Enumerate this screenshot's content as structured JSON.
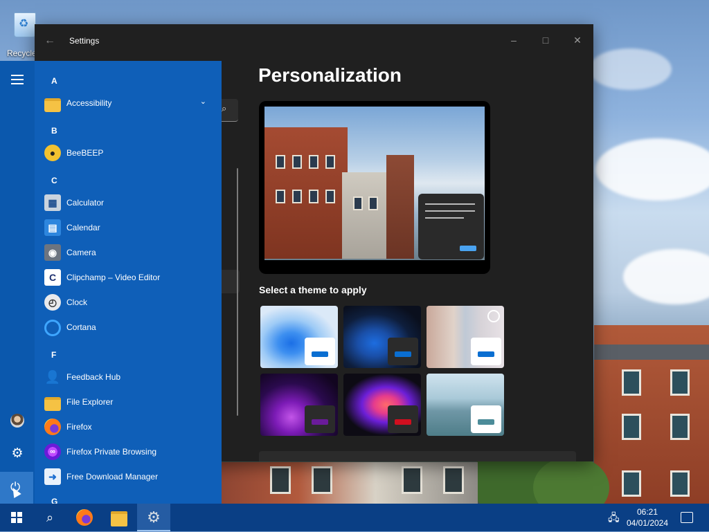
{
  "desktop": {
    "recycle_bin_label": "Recycle"
  },
  "settings_window": {
    "title": "Settings",
    "back_icon": "arrow-left-icon",
    "controls": {
      "minimize": "–",
      "maximize": "□",
      "close": "✕"
    },
    "page_title": "Personalization",
    "theme_section_label": "Select a theme to apply",
    "themes": [
      {
        "name": "windows-light",
        "accent": "#0a6ed1"
      },
      {
        "name": "windows-dark",
        "accent": "#0a6ed1"
      },
      {
        "name": "captured-motion",
        "accent": "#0a6ed1"
      },
      {
        "name": "glow",
        "accent": "#6a1b9a"
      },
      {
        "name": "captured-flow",
        "accent": "#d10f1f"
      },
      {
        "name": "sunrise",
        "accent": "#4c8c99"
      }
    ]
  },
  "start_menu": {
    "groups": [
      {
        "letter": "A",
        "apps": [
          {
            "label": "Accessibility",
            "icon": "folder-icon",
            "expandable": true
          }
        ]
      },
      {
        "letter": "B",
        "apps": [
          {
            "label": "BeeBEEP",
            "icon": "bee-icon"
          }
        ]
      },
      {
        "letter": "C",
        "apps": [
          {
            "label": "Calculator",
            "icon": "calculator-icon"
          },
          {
            "label": "Calendar",
            "icon": "calendar-icon"
          },
          {
            "label": "Camera",
            "icon": "camera-icon"
          },
          {
            "label": "Clipchamp – Video Editor",
            "icon": "clipchamp-icon"
          },
          {
            "label": "Clock",
            "icon": "clock-icon"
          },
          {
            "label": "Cortana",
            "icon": "cortana-icon"
          }
        ]
      },
      {
        "letter": "F",
        "apps": [
          {
            "label": "Feedback Hub",
            "icon": "feedback-icon"
          },
          {
            "label": "File Explorer",
            "icon": "folder-icon"
          },
          {
            "label": "Firefox",
            "icon": "firefox-icon"
          },
          {
            "label": "Firefox Private Browsing",
            "icon": "firefox-private-icon"
          },
          {
            "label": "Free Download Manager",
            "icon": "download-manager-icon"
          }
        ]
      },
      {
        "letter": "G",
        "apps": []
      }
    ],
    "chevron": "⌄"
  },
  "taskbar": {
    "clock_time": "06:21",
    "clock_date": "04/01/2024"
  }
}
